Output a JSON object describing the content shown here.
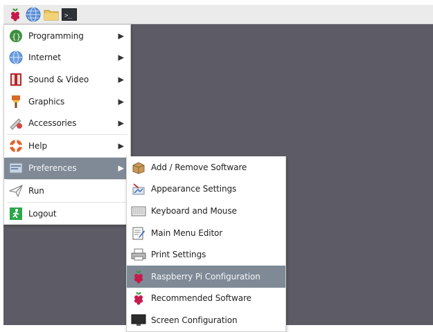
{
  "main_menu": {
    "items": [
      {
        "label": "Programming",
        "icon": "programming-icon",
        "has_submenu": true
      },
      {
        "label": "Internet",
        "icon": "globe-icon",
        "has_submenu": true
      },
      {
        "label": "Sound & Video",
        "icon": "sound-video-icon",
        "has_submenu": true
      },
      {
        "label": "Graphics",
        "icon": "paintbrush-icon",
        "has_submenu": true
      },
      {
        "label": "Accessories",
        "icon": "accessories-icon",
        "has_submenu": true
      },
      {
        "label": "Help",
        "icon": "lifebuoy-icon",
        "has_submenu": true
      },
      {
        "label": "Preferences",
        "icon": "preferences-icon",
        "has_submenu": true,
        "selected": true
      },
      {
        "label": "Run",
        "icon": "paper-plane-icon",
        "has_submenu": false
      },
      {
        "label": "Logout",
        "icon": "logout-icon",
        "has_submenu": false
      }
    ]
  },
  "preferences_menu": {
    "items": [
      {
        "label": "Add / Remove Software",
        "icon": "package-icon"
      },
      {
        "label": "Appearance Settings",
        "icon": "appearance-icon"
      },
      {
        "label": "Keyboard and Mouse",
        "icon": "keyboard-icon"
      },
      {
        "label": "Main Menu Editor",
        "icon": "menu-editor-icon"
      },
      {
        "label": "Print Settings",
        "icon": "printer-icon"
      },
      {
        "label": "Raspberry Pi Configuration",
        "icon": "raspberry-icon",
        "selected": true
      },
      {
        "label": "Recommended Software",
        "icon": "raspberry-icon"
      },
      {
        "label": "Screen Configuration",
        "icon": "monitor-icon"
      }
    ]
  },
  "taskbar": {
    "icons": [
      "raspberry-menu-icon",
      "browser-icon",
      "file-manager-icon",
      "terminal-icon"
    ],
    "terminal_glyph": ">_"
  },
  "colors": {
    "desktop": "#5d5c66",
    "selected": "#7f8a96"
  }
}
